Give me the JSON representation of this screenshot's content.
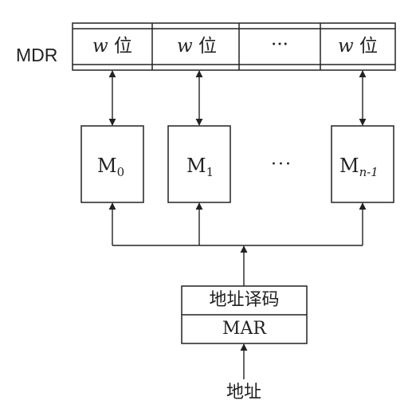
{
  "diagram": {
    "mdr_label": "MDR",
    "mdr_cells": [
      {
        "var": "w",
        "unit": "位"
      },
      {
        "var": "w",
        "unit": "位"
      },
      {
        "ellipsis": "···"
      },
      {
        "var": "w",
        "unit": "位"
      }
    ],
    "modules": [
      {
        "base": "M",
        "sub": "0"
      },
      {
        "base": "M",
        "sub": "1"
      },
      {
        "ellipsis": "···"
      },
      {
        "base": "M",
        "sub": "n-1"
      }
    ],
    "decoder_label": "地址译码",
    "mar_label": "MAR",
    "address_label": "地址",
    "colors": {
      "line": "#222222",
      "background": "#ffffff"
    }
  }
}
